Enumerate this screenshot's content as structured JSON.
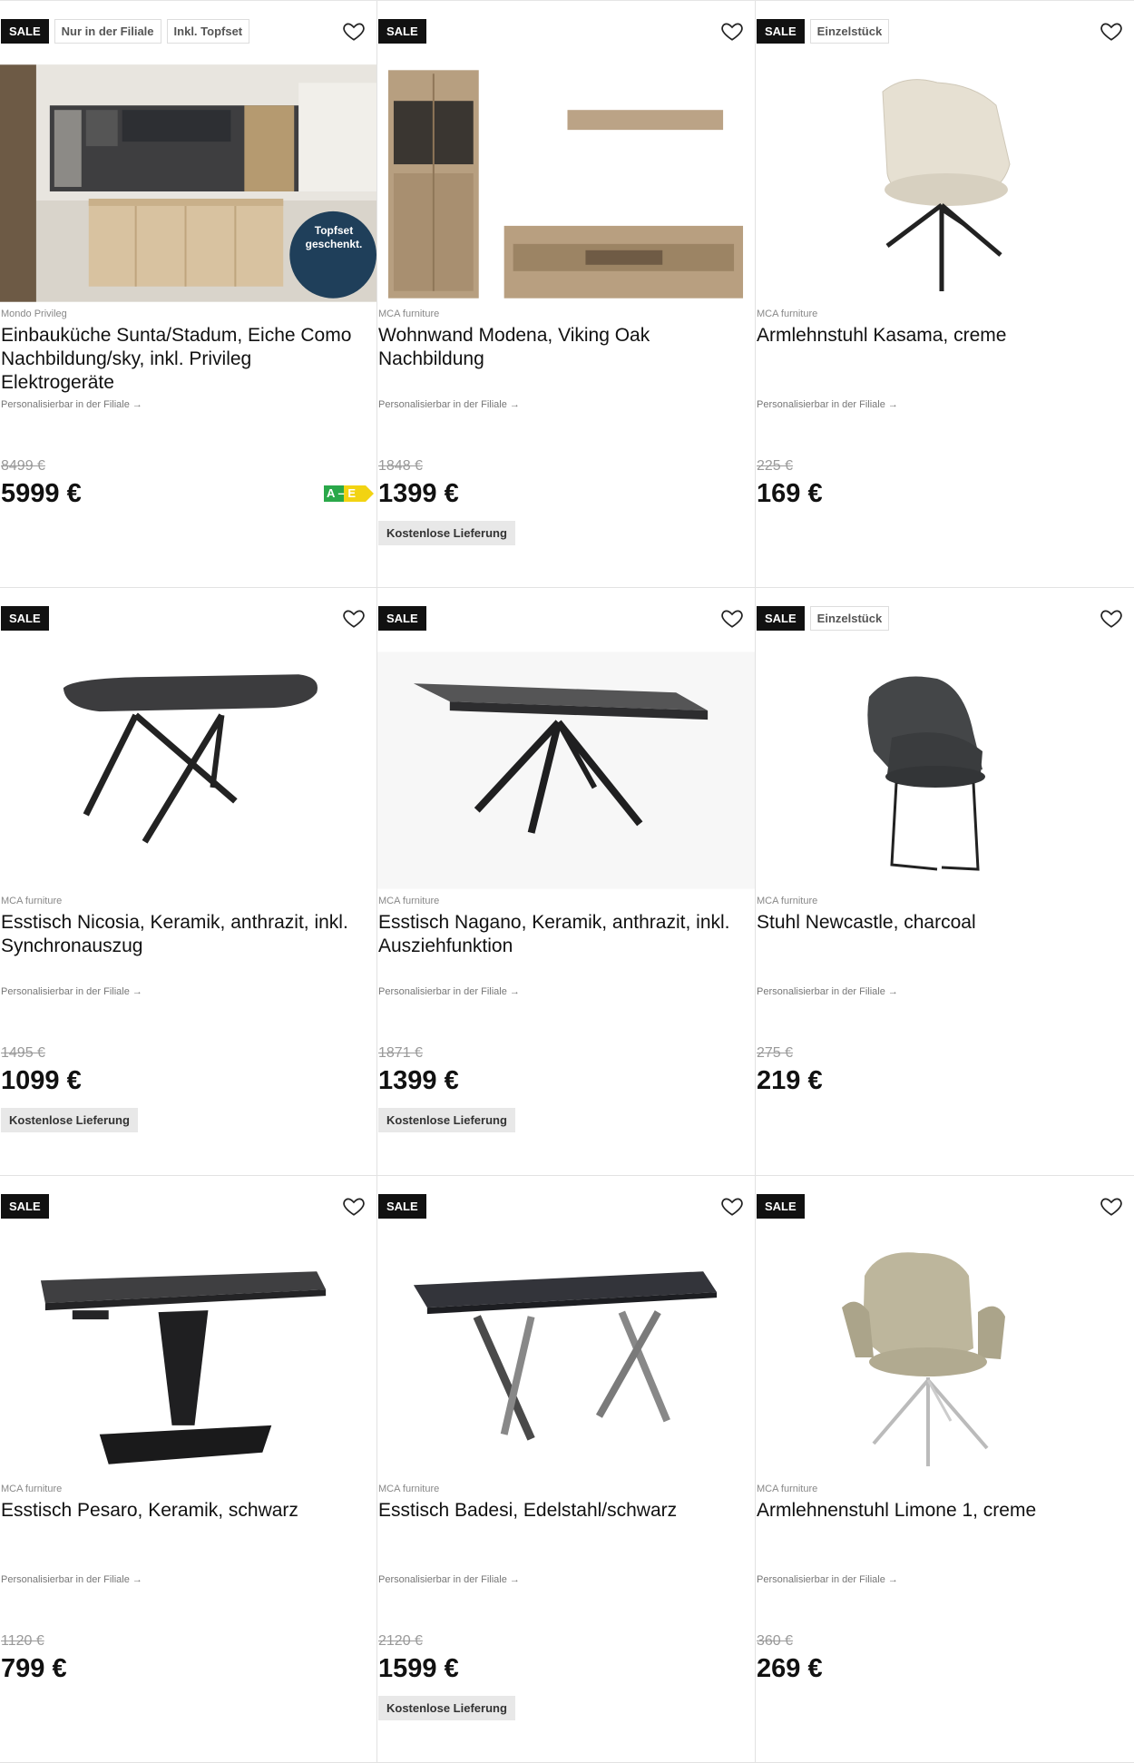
{
  "products": [
    {
      "badges": [
        "SALE",
        "Nur in der Filiale",
        "Inkl. Topfset"
      ],
      "image": "kitchen-island-photo",
      "image_overlay": "Topfset geschenkt.",
      "brand": "Mondo Privileg",
      "title": "Einbauküche Sunta/Stadum, Eiche Como Nachbildung/sky, inkl. Privileg Elektrogeräte",
      "personalize": "Personalisierbar in der Filiale →",
      "old_price": "8499 €",
      "price": "5999 €",
      "energy": "A – E",
      "delivery": ""
    },
    {
      "badges": [
        "SALE"
      ],
      "image": "wall-unit",
      "brand": "MCA furniture",
      "title": "Wohnwand Modena, Viking Oak Nachbildung",
      "personalize": "Personalisierbar in der Filiale →",
      "old_price": "1848 €",
      "price": "1399 €",
      "delivery": "Kostenlose Lieferung"
    },
    {
      "badges": [
        "SALE",
        "Einzelstück"
      ],
      "image": "armchair-cream",
      "brand": "MCA furniture",
      "title": "Armlehnstuhl Kasama, creme",
      "personalize": "Personalisierbar in der Filiale →",
      "old_price": "225 €",
      "price": "169 €",
      "delivery": ""
    },
    {
      "badges": [
        "SALE"
      ],
      "image": "table-cross-legs",
      "brand": "MCA furniture",
      "title": "Esstisch Nicosia, Keramik, anthrazit, inkl. Synchronauszug",
      "personalize": "Personalisierbar in der Filiale →",
      "old_price": "1495 €",
      "price": "1099 €",
      "delivery": "Kostenlose Lieferung"
    },
    {
      "badges": [
        "SALE"
      ],
      "image": "table-star-legs",
      "brand": "MCA furniture",
      "title": "Esstisch Nagano, Keramik, anthrazit, inkl. Ausziehfunktion",
      "personalize": "Personalisierbar in der Filiale →",
      "old_price": "1871 €",
      "price": "1399 €",
      "delivery": "Kostenlose Lieferung"
    },
    {
      "badges": [
        "SALE",
        "Einzelstück"
      ],
      "image": "chair-charcoal",
      "brand": "MCA furniture",
      "title": "Stuhl Newcastle, charcoal",
      "personalize": "Personalisierbar in der Filiale →",
      "old_price": "275 €",
      "price": "219 €",
      "delivery": ""
    },
    {
      "badges": [
        "SALE"
      ],
      "image": "table-pedestal",
      "brand": "MCA furniture",
      "title": "Esstisch Pesaro, Keramik, schwarz",
      "personalize": "Personalisierbar in der Filiale →",
      "old_price": "1120 €",
      "price": "799 €",
      "delivery": ""
    },
    {
      "badges": [
        "SALE"
      ],
      "image": "table-x-legs-steel",
      "brand": "MCA furniture",
      "title": "Esstisch Badesi, Edelstahl/schwarz",
      "personalize": "Personalisierbar in der Filiale →",
      "old_price": "2120 €",
      "price": "1599 €",
      "delivery": "Kostenlose Lieferung"
    },
    {
      "badges": [
        "SALE"
      ],
      "image": "armchair-olive-swivel",
      "brand": "MCA furniture",
      "title": "Armlehnenstuhl Limone 1, creme",
      "personalize": "Personalisierbar in der Filiale →",
      "old_price": "360 €",
      "price": "269 €",
      "delivery": ""
    }
  ],
  "colors": {
    "sale_badge_bg": "#111111",
    "delivery_bg": "#e8e8e8",
    "energy_green": "#2aa84a",
    "energy_yellow": "#f2d312"
  }
}
